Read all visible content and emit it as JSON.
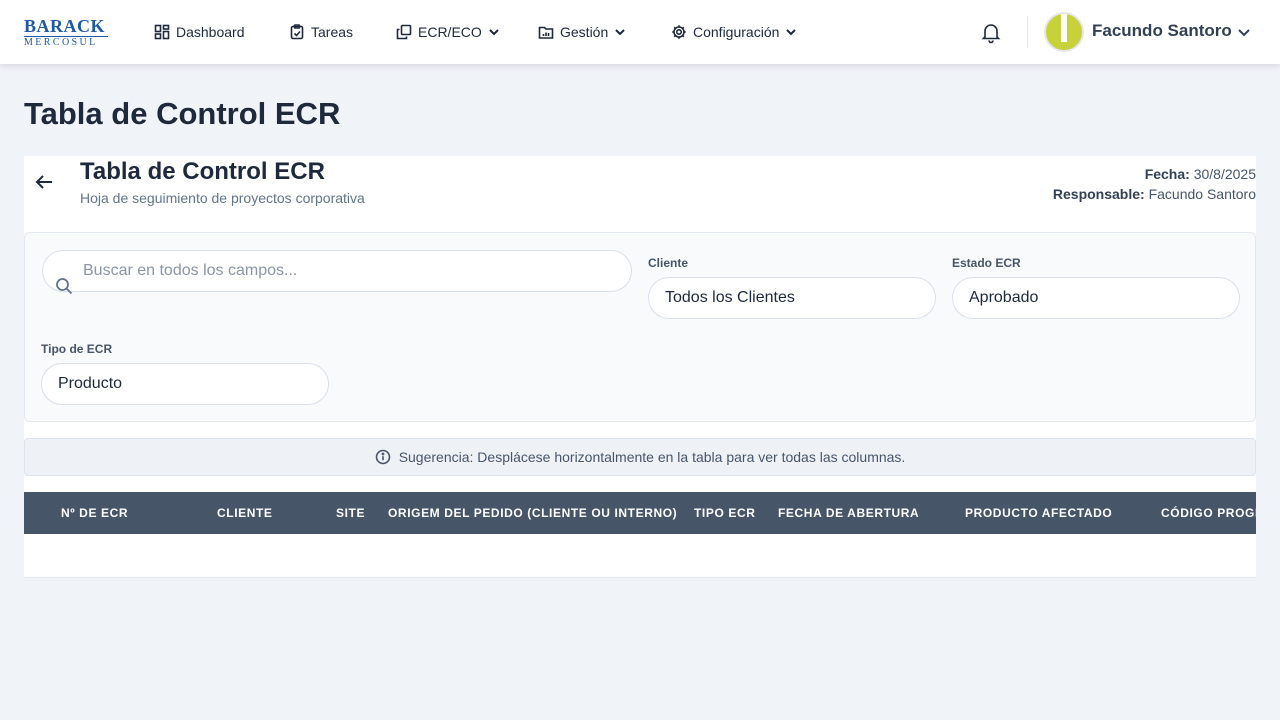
{
  "nav": {
    "logo_top": "BARACK",
    "logo_bottom": "MERCOSUL",
    "items": [
      {
        "label": "Dashboard",
        "icon": "dashboard-icon"
      },
      {
        "label": "Tareas",
        "icon": "clipboard-icon"
      },
      {
        "label": "ECR/ECO",
        "icon": "copy-icon",
        "dropdown": true
      },
      {
        "label": "Gestión",
        "icon": "folder-chart-icon",
        "dropdown": true
      },
      {
        "label": "Configuración",
        "icon": "gear-icon",
        "dropdown": true
      }
    ],
    "user_name": "Facundo Santoro",
    "avatar_color": "#c7d13a"
  },
  "page": {
    "title": "Tabla de Control ECR"
  },
  "card": {
    "title": "Tabla de Control ECR",
    "subtitle": "Hoja de seguimiento de proyectos corporativa",
    "fecha_label": "Fecha:",
    "fecha_value": "30/8/2025",
    "responsable_label": "Responsable:",
    "responsable_value": "Facundo Santoro"
  },
  "filters": {
    "search_placeholder": "Buscar en todos los campos...",
    "cliente_label": "Cliente",
    "cliente_value": "Todos los Clientes",
    "estado_label": "Estado ECR",
    "estado_value": "Aprobado",
    "tipo_label": "Tipo de ECR",
    "tipo_value": "Producto"
  },
  "hint": {
    "text": "Sugerencia: Desplácese horizontalmente en la tabla para ver todas las columnas."
  },
  "table": {
    "header_color": "#475569",
    "columns": [
      "Nº DE ECR",
      "CLIENTE",
      "SITE",
      "ORIGEM DEL PEDIDO (CLIENTE OU INTERNO)",
      "TIPO ECR",
      "FECHA DE ABERTURA",
      "PRODUCTO AFECTADO",
      "CÓDIGO PROGRAMA"
    ],
    "rows": []
  }
}
